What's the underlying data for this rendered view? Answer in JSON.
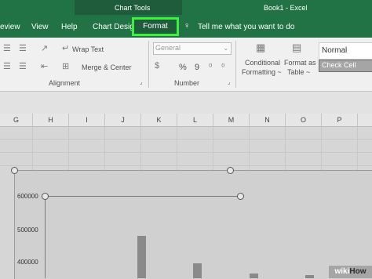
{
  "title": {
    "context": "Chart Tools",
    "app": "Book1  -  Excel"
  },
  "tabs": [
    "eview",
    "View",
    "Help",
    "Chart Design",
    "Format"
  ],
  "tell_me": "Tell me what you want to do",
  "ribbon": {
    "wrap_text": "Wrap Text",
    "merge_center": "Merge & Center",
    "alignment_label": "Alignment",
    "number_format": "General",
    "percent": "%",
    "comma": "9",
    "number_label": "Number",
    "conditional_formatting": [
      "Conditional",
      "Formatting ~"
    ],
    "format_as_table": [
      "Format as",
      "Table ~"
    ],
    "style_normal": "Normal",
    "style_check_cell": "Check Cell"
  },
  "columns": [
    "G",
    "H",
    "I",
    "J",
    "K",
    "L",
    "M",
    "N",
    "O",
    "P"
  ],
  "chart_data": {
    "type": "bar",
    "y_ticks": [
      "600000",
      "500000",
      "400000"
    ],
    "ylim": [
      350000,
      600000
    ],
    "values": [
      480000,
      395000,
      365000,
      360000
    ]
  },
  "watermark": {
    "prefix": "wiki",
    "suffix": "How"
  },
  "colors": {
    "excel_green": "#217346",
    "highlight": "#3cf03c"
  }
}
